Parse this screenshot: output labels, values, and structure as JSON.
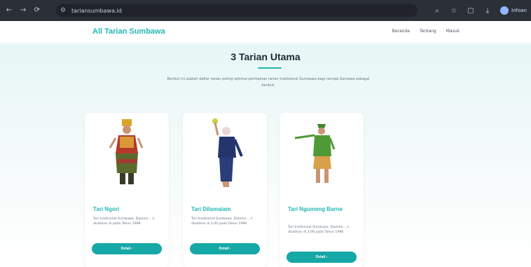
{
  "browser": {
    "url": "tariansumbawa.id",
    "profile_name": "Infoan",
    "icons": [
      "back-icon",
      "forward-icon",
      "reload-icon",
      "site-info-icon",
      "search-icon",
      "star-icon",
      "extensions-icon",
      "download-icon"
    ]
  },
  "header": {
    "brand": "All Tarian Sumbawa",
    "menu": [
      "Beranda",
      "Tentang",
      "Masuk"
    ]
  },
  "main": {
    "title": "3 Tarian Utama",
    "lead": "Berikut ini adalah daftar tarian paling optimal permainan tarian tradisional Sumbawa bagi remaja Samawa sebagai berikut:",
    "cards": [
      {
        "name": "Tari Ngori",
        "description": "Tari tradisional Sumbawa. Diperkir... ir disahkan di pada Tahun 1998",
        "button": "Detail ›"
      },
      {
        "name": "Tari Dilamaiam",
        "description": "Tari tradisional Sumbawa. Diperkir... ir disahkan di 2,00 pada Tahun 1998",
        "button": "Detail ›"
      },
      {
        "name": "Tari Ngumeng Barne",
        "description": "Tari tradisional Sumbawa. Diperkir... ir disahkan di 2,00 pada Tahun 1998",
        "button": "Detail ›"
      }
    ]
  },
  "colors": {
    "accent": "#22b8b5",
    "button": "#15a8a6",
    "chrome": "#2b2f36",
    "background_top": "#e6f7f6"
  }
}
